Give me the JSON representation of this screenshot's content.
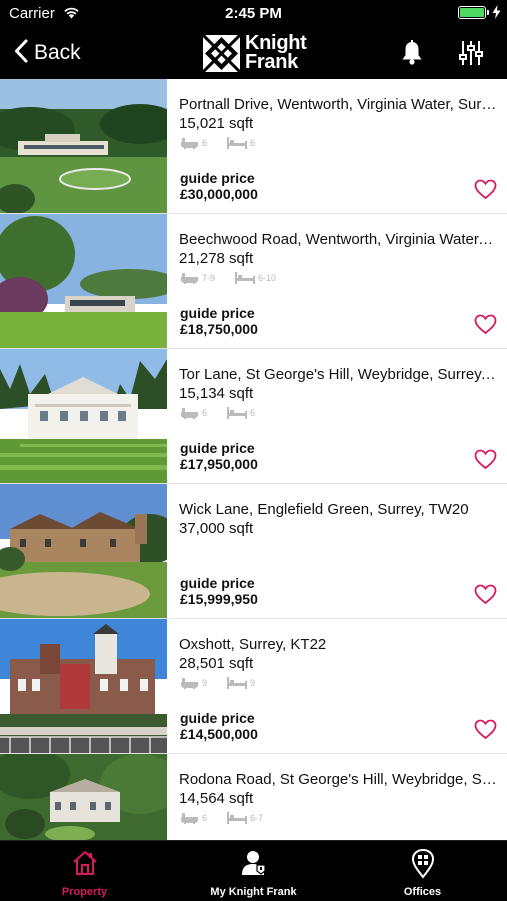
{
  "status": {
    "carrier": "Carrier",
    "time": "2:45 PM"
  },
  "nav": {
    "back_label": "Back",
    "logo_line1": "Knight",
    "logo_line2": "Frank"
  },
  "listings": [
    {
      "address": "Portnall Drive, Wentworth, Virginia Water, Surr…",
      "sqft": "15,021 sqft",
      "baths": "6",
      "beds": "6",
      "price_label": "guide price",
      "price": "£30,000,000"
    },
    {
      "address": "Beechwood Road, Wentworth, Virginia Water,…",
      "sqft": "21,278 sqft",
      "baths": "7-9",
      "beds": "6-10",
      "price_label": "guide price",
      "price": "£18,750,000"
    },
    {
      "address": "Tor Lane, St George's Hill, Weybridge, Surrey,…",
      "sqft": "15,134 sqft",
      "baths": "6",
      "beds": "6",
      "price_label": "guide price",
      "price": "£17,950,000"
    },
    {
      "address": "Wick Lane, Englefield Green, Surrey, TW20",
      "sqft": "37,000 sqft",
      "baths": "",
      "beds": "",
      "price_label": "guide price",
      "price": "£15,999,950"
    },
    {
      "address": "Oxshott, Surrey, KT22",
      "sqft": "28,501 sqft",
      "baths": "9",
      "beds": "9",
      "price_label": "guide price",
      "price": "£14,500,000"
    },
    {
      "address": "Rodona Road, St George's Hill, Weybridge, S…",
      "sqft": "14,564 sqft",
      "baths": "6",
      "beds": "6-7",
      "price_label": "",
      "price": ""
    }
  ],
  "tabs": [
    {
      "label": "Property",
      "icon": "house-icon",
      "active": true
    },
    {
      "label": "My Knight Frank",
      "icon": "person-icon",
      "active": false
    },
    {
      "label": "Offices",
      "icon": "map-pin-icon",
      "active": false
    }
  ],
  "colors": {
    "accent": "#d81b60",
    "background": "#000000",
    "battery": "#4cd964"
  }
}
